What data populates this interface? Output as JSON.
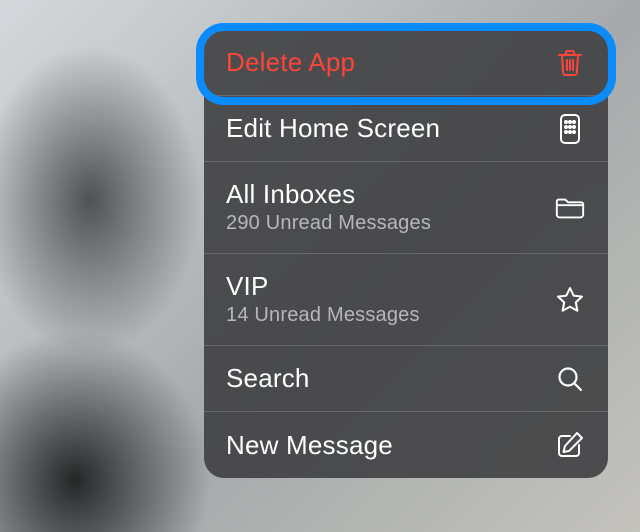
{
  "menu": {
    "items": [
      {
        "title": "Delete App",
        "subtitle": null,
        "icon": "trash-icon",
        "destructive": true
      },
      {
        "title": "Edit Home Screen",
        "subtitle": null,
        "icon": "home-grid-icon",
        "destructive": false
      },
      {
        "title": "All Inboxes",
        "subtitle": "290 Unread Messages",
        "icon": "folder-icon",
        "destructive": false
      },
      {
        "title": "VIP",
        "subtitle": "14 Unread Messages",
        "icon": "star-icon",
        "destructive": false
      },
      {
        "title": "Search",
        "subtitle": null,
        "icon": "search-icon",
        "destructive": false
      },
      {
        "title": "New Message",
        "subtitle": null,
        "icon": "compose-icon",
        "destructive": false
      }
    ]
  },
  "annotation": {
    "highlighted_item_index": 0,
    "ring_color": "#0a8cff"
  }
}
